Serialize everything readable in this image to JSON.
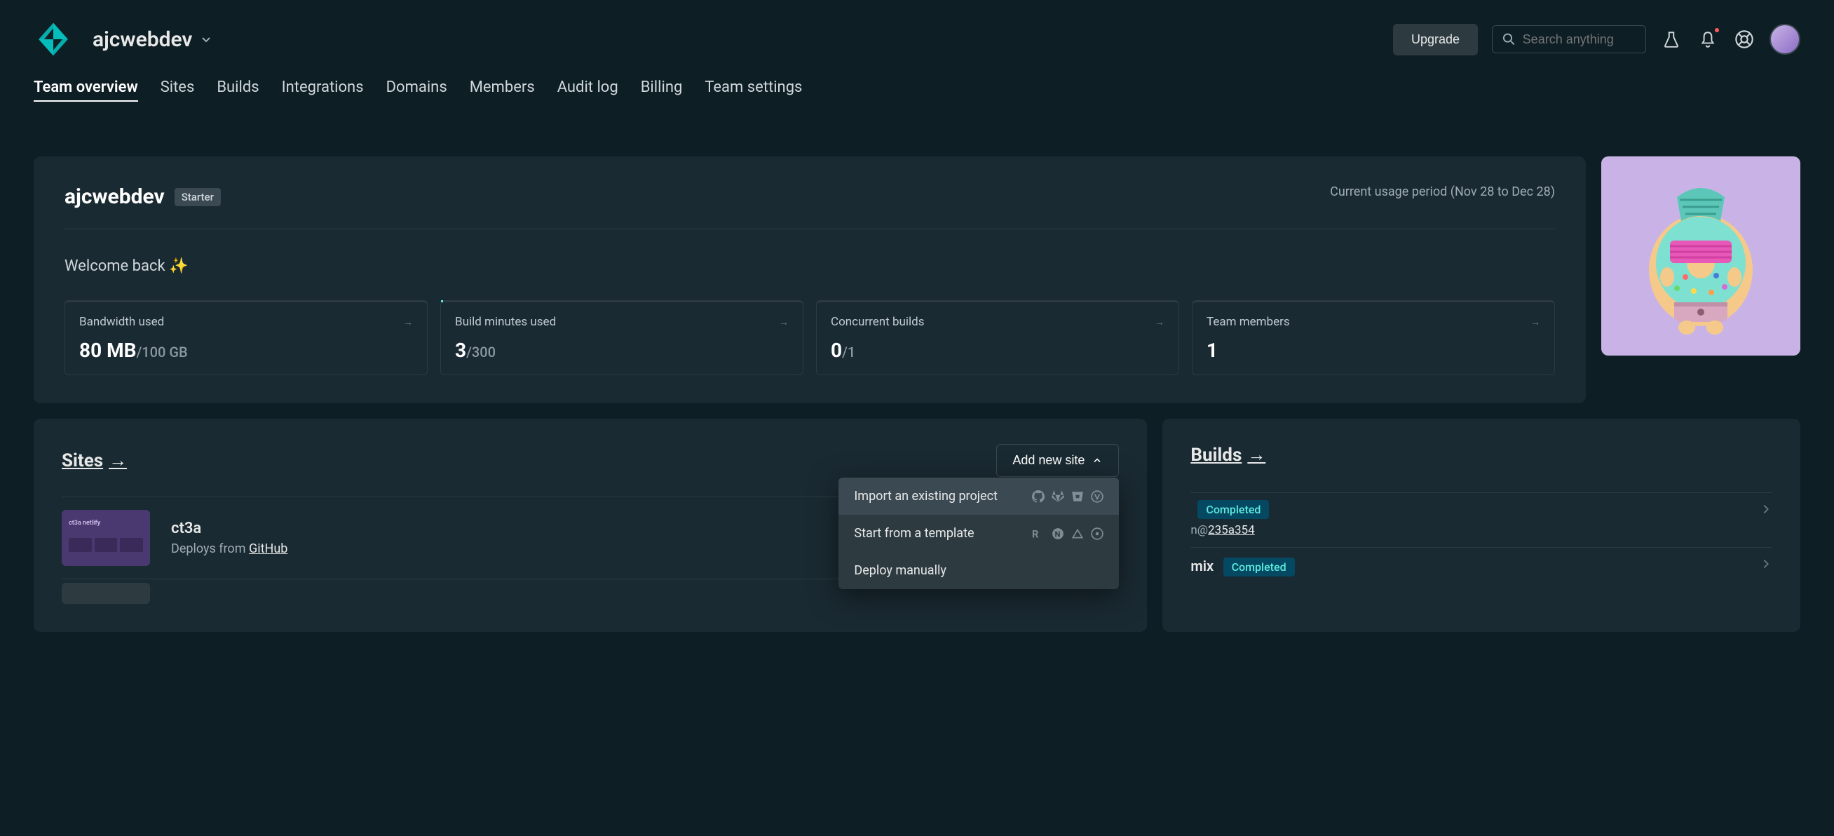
{
  "header": {
    "team_selector": "ajcwebdev",
    "upgrade_label": "Upgrade",
    "search_placeholder": "Search anything"
  },
  "nav": {
    "tabs": [
      "Team overview",
      "Sites",
      "Builds",
      "Integrations",
      "Domains",
      "Members",
      "Audit log",
      "Billing",
      "Team settings"
    ],
    "active_index": 0
  },
  "overview": {
    "team_name": "ajcwebdev",
    "plan_badge": "Starter",
    "usage_period": "Current usage period (Nov 28 to Dec 28)",
    "welcome": "Welcome back ✨",
    "metrics": [
      {
        "label": "Bandwidth used",
        "value": "80 MB",
        "limit": "/100 GB"
      },
      {
        "label": "Build minutes used",
        "value": "3",
        "limit": "/300"
      },
      {
        "label": "Concurrent builds",
        "value": "0",
        "limit": "/1"
      },
      {
        "label": "Team members",
        "value": "1",
        "limit": ""
      }
    ]
  },
  "sites_panel": {
    "title": "Sites",
    "add_btn": "Add new site",
    "dropdown": {
      "import": "Import an existing project",
      "template": "Start from a template",
      "manual": "Deploy manually"
    },
    "site": {
      "name": "ct3a",
      "deploys_from_prefix": "Deploys from ",
      "deploys_from_link": "GitHub",
      "thumb_text": "ct3a netlify"
    }
  },
  "builds_panel": {
    "title": "Builds",
    "badge_completed": "Completed",
    "branch_prefix": "n@",
    "commit_hash": "235a354",
    "second_build_suffix": "mix"
  }
}
